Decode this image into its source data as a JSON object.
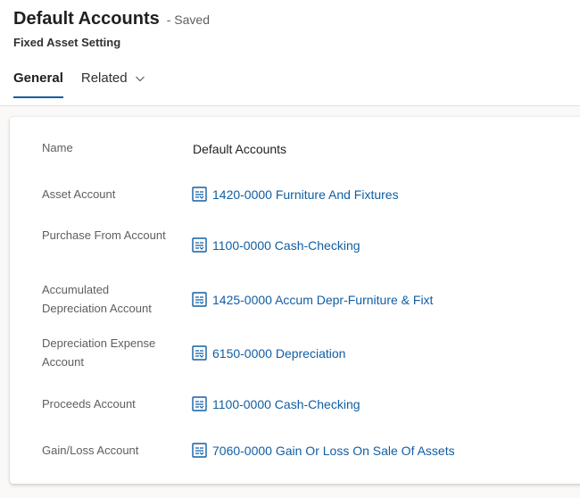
{
  "header": {
    "title": "Default Accounts",
    "status": "- Saved",
    "subtitle": "Fixed Asset Setting"
  },
  "tabs": [
    {
      "label": "General",
      "active": true
    },
    {
      "label": "Related",
      "active": false
    }
  ],
  "colors": {
    "link": "#115ea3",
    "accent": "#115ea3",
    "label": "#605e5c",
    "text": "#201f1e"
  },
  "fields": {
    "name": {
      "label": "Name",
      "value": "Default Accounts"
    },
    "asset_account": {
      "label": "Asset Account",
      "value": "1420-0000 Furniture And Fixtures",
      "icon": "lookup-record-icon"
    },
    "purchase_from_account": {
      "label": "Purchase From Account",
      "value": "1100-0000 Cash-Checking",
      "icon": "lookup-record-icon"
    },
    "accumulated_depreciation_account": {
      "label": "Accumulated Depreciation Account",
      "value": "1425-0000 Accum Depr-Furniture & Fixt",
      "icon": "lookup-record-icon"
    },
    "depreciation_expense_account": {
      "label": "Depreciation Expense Account",
      "value": "6150-0000 Depreciation",
      "icon": "lookup-record-icon"
    },
    "proceeds_account": {
      "label": "Proceeds Account",
      "value": "1100-0000 Cash-Checking",
      "icon": "lookup-record-icon"
    },
    "gain_loss_account": {
      "label": "Gain/Loss Account",
      "value": "7060-0000 Gain Or Loss On Sale Of Assets",
      "icon": "lookup-record-icon"
    }
  }
}
